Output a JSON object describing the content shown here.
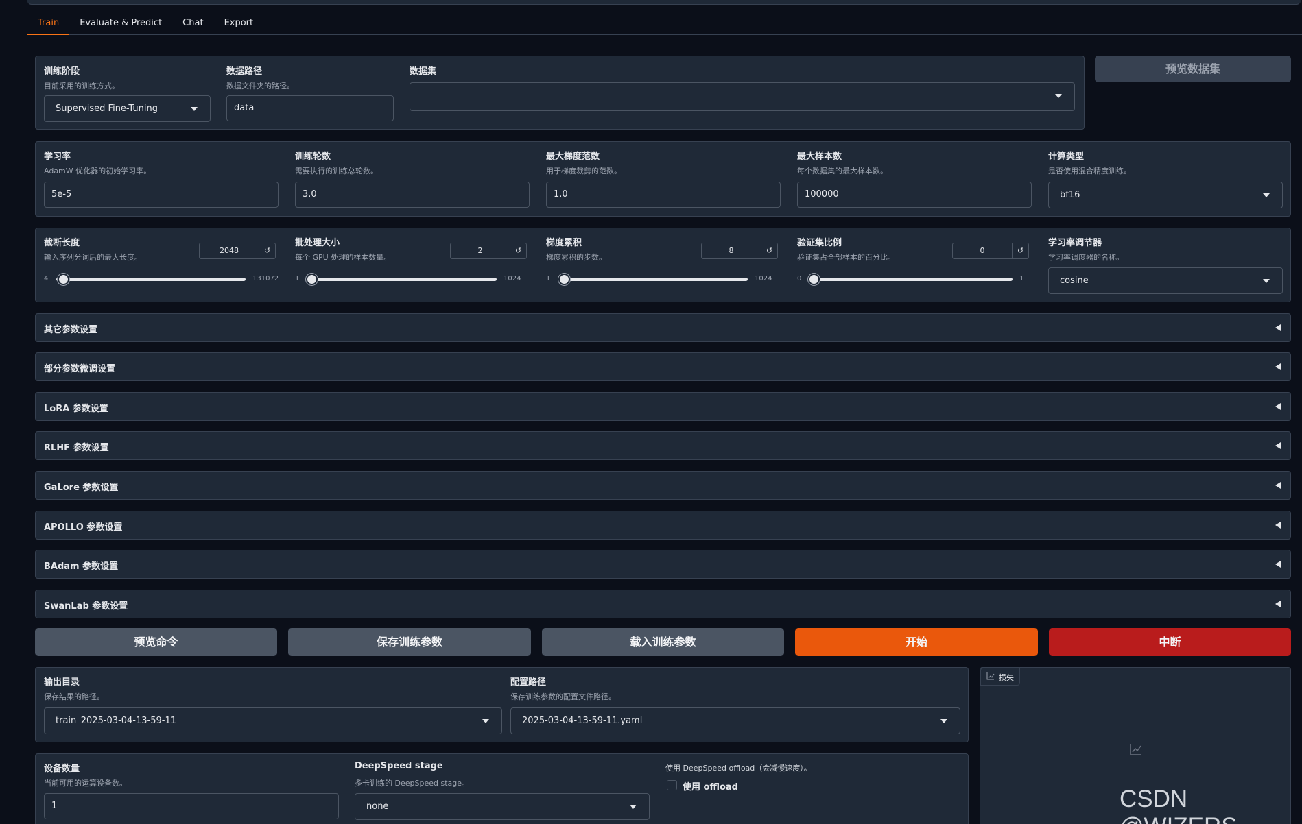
{
  "tabs": [
    "Train",
    "Evaluate & Predict",
    "Chat",
    "Export"
  ],
  "stage": {
    "label": "训练阶段",
    "info": "目前采用的训练方式。",
    "value": "Supervised Fine-Tuning"
  },
  "dataset_dir": {
    "label": "数据路径",
    "info": "数据文件夹的路径。",
    "value": "data"
  },
  "dataset": {
    "label": "数据集",
    "value": ""
  },
  "preview_dataset_btn": "预览数据集",
  "learning_rate": {
    "label": "学习率",
    "info": "AdamW 优化器的初始学习率。",
    "value": "5e-5"
  },
  "epochs": {
    "label": "训练轮数",
    "info": "需要执行的训练总轮数。",
    "value": "3.0"
  },
  "max_grad_norm": {
    "label": "最大梯度范数",
    "info": "用于梯度裁剪的范数。",
    "value": "1.0"
  },
  "max_samples": {
    "label": "最大样本数",
    "info": "每个数据集的最大样本数。",
    "value": "100000"
  },
  "compute_type": {
    "label": "计算类型",
    "info": "是否使用混合精度训练。",
    "value": "bf16"
  },
  "sliders": [
    {
      "label": "截断长度",
      "info": "输入序列分词后的最大长度。",
      "value": "2048",
      "min": "4",
      "max": "131072",
      "reset": "↺",
      "level": 0.016
    },
    {
      "label": "批处理大小",
      "info": "每个 GPU 处理的样本数量。",
      "value": "2",
      "min": "1",
      "max": "1024",
      "reset": "↺",
      "level": 0.001
    },
    {
      "label": "梯度累积",
      "info": "梯度累积的步数。",
      "value": "8",
      "min": "1",
      "max": "1024",
      "reset": "↺",
      "level": 0.007
    },
    {
      "label": "验证集比例",
      "info": "验证集占全部样本的百分比。",
      "value": "0",
      "min": "0",
      "max": "1",
      "reset": "↺",
      "level": 0
    }
  ],
  "lr_scheduler": {
    "label": "学习率调节器",
    "info": "学习率调度器的名称。",
    "value": "cosine"
  },
  "accordions": [
    "其它参数设置",
    "部分参数微调设置",
    "LoRA 参数设置",
    "RLHF 参数设置",
    "GaLore 参数设置",
    "APOLLO 参数设置",
    "BAdam 参数设置",
    "SwanLab 参数设置"
  ],
  "buttons": {
    "preview_cmd": "预览命令",
    "save_args": "保存训练参数",
    "load_args": "载入训练参数",
    "start": "开始",
    "stop": "中断"
  },
  "output_dir": {
    "label": "输出目录",
    "info": "保存结果的路径。",
    "value": "train_2025-03-04-13-59-11"
  },
  "config_path": {
    "label": "配置路径",
    "info": "保存训练参数的配置文件路径。",
    "value": "2025-03-04-13-59-11.yaml"
  },
  "device_count": {
    "label": "设备数量",
    "info": "当前可用的运算设备数。",
    "value": "1"
  },
  "ds_stage": {
    "label": "DeepSpeed stage",
    "info": "多卡训练的 DeepSpeed stage。",
    "value": "none"
  },
  "ds_offload": {
    "info": "使用 DeepSpeed offload（会减慢速度）。",
    "label": "使用 offload"
  },
  "loss_plot": {
    "label": "损失"
  },
  "watermark": "CSDN @WIZERS",
  "colors": {
    "accent": "#f97316",
    "start": "#ea580c",
    "stop": "#b91c1c",
    "background": "#0b0f19",
    "panel": "#1f2937"
  }
}
